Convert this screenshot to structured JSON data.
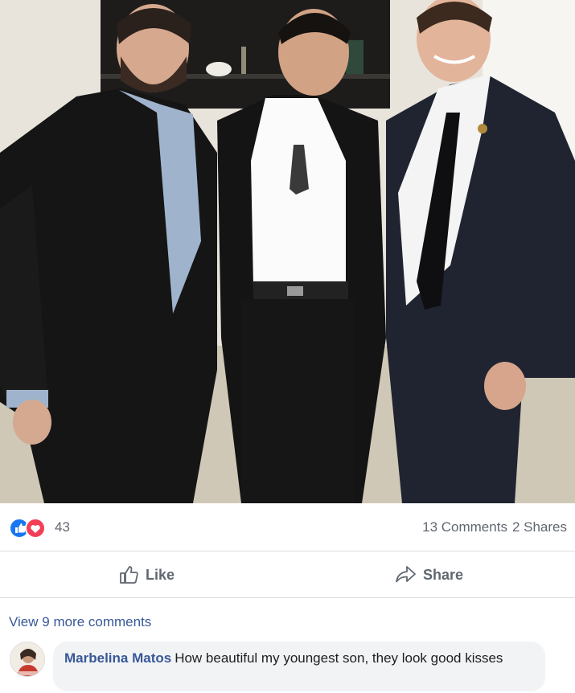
{
  "post": {
    "photo_icon": "photo-of-three-men-in-suits",
    "reactions": {
      "icons": [
        "like-icon",
        "love-icon"
      ],
      "count": "43"
    },
    "stats": {
      "comments": "13 Comments",
      "shares": "2 Shares"
    },
    "actions": {
      "like_label": "Like",
      "like_icon": "thumbs-up-icon",
      "share_label": "Share",
      "share_icon": "share-arrow-icon"
    }
  },
  "comments": {
    "view_more": "View 9 more comments",
    "items": [
      {
        "author": "Marbelina Matos",
        "text": "How beautiful my youngest son, they look good kisses",
        "avatar_icon": "user-avatar-icon"
      }
    ]
  },
  "colors": {
    "link": "#385898",
    "muted": "#606770",
    "like_blue": "#1877f2",
    "love_red": "#f33e58",
    "bubble": "#f2f3f5",
    "divider": "#dadde1"
  }
}
